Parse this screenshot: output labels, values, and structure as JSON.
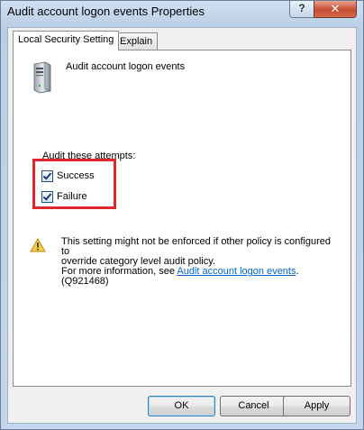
{
  "window": {
    "title": "Audit account logon events Properties",
    "help_label": "?",
    "close_label": "✕"
  },
  "tabs": [
    {
      "label": "Local Security Setting",
      "active": true
    },
    {
      "label": "Explain",
      "active": false
    }
  ],
  "policy": {
    "name": "Audit account logon events",
    "icon": "server-computer-icon"
  },
  "audit": {
    "label": "Audit these attempts:",
    "success_label": "Success",
    "success_checked": true,
    "failure_label": "Failure",
    "failure_checked": true
  },
  "warning": {
    "icon": "warning-triangle-icon",
    "line1": "This setting might not be enforced if other policy is configured to",
    "line2": "override category level audit policy.",
    "more_prefix": "For more information, see ",
    "link_text": "Audit account logon events",
    "kb_suffix": ". (Q921468)"
  },
  "buttons": {
    "ok": "OK",
    "cancel": "Cancel",
    "apply": "Apply"
  },
  "colors": {
    "highlight": "#e1262d",
    "link": "#0066cc"
  }
}
